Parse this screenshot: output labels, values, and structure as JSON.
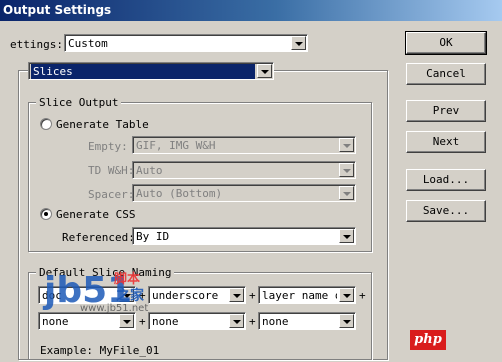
{
  "window": {
    "title": "Output Settings"
  },
  "settings": {
    "label": "ettings:",
    "value": "Custom"
  },
  "section": {
    "value": "Slices"
  },
  "buttons": {
    "ok": "OK",
    "cancel": "Cancel",
    "prev": "Prev",
    "next": "Next",
    "load": "Load...",
    "save": "Save..."
  },
  "slice_output": {
    "title": "Slice Output",
    "generate_table": "Generate Table",
    "empty_label": "Empty:",
    "empty_value": "GIF, IMG W&H",
    "td_label": "TD W&H:",
    "td_value": "Auto",
    "spacer_label": "Spacer:",
    "spacer_value": "Auto (Bottom)",
    "generate_css": "Generate CSS",
    "referenced_label": "Referenced:",
    "referenced_value": "By ID"
  },
  "naming": {
    "title": "Default Slice Naming",
    "row1": [
      "doc",
      "underscore",
      "layer name or"
    ],
    "row2": [
      "none",
      "none",
      "none"
    ],
    "plus": "+",
    "example": "Example: MyFile_01"
  },
  "watermark": {
    "jb": "jb51",
    "jiao": "脚本",
    "zhijia": "之家",
    "url": "www.jb51.net",
    "php": "php"
  },
  "colors": {
    "dialog": "#d4d0c8",
    "title_bar": "#0a246a",
    "selection": "#0a246a",
    "php_logo": "#d91c1c"
  }
}
